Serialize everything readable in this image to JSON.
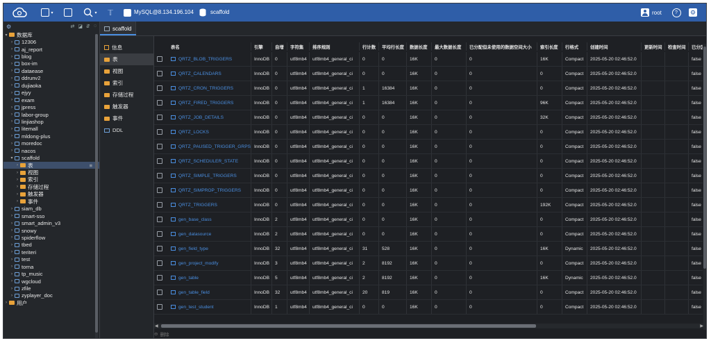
{
  "toolbar": {
    "connection": "MySQL@8.134.196.104",
    "database": "scaffold",
    "user": "root",
    "accent": "#2f5ea8"
  },
  "tree": {
    "root": "数据库",
    "items": [
      {
        "label": "12306",
        "level": 1
      },
      {
        "label": "aj_report",
        "level": 1
      },
      {
        "label": "blog",
        "level": 1
      },
      {
        "label": "box-im",
        "level": 1
      },
      {
        "label": "dataease",
        "level": 1
      },
      {
        "label": "ddrunv2",
        "level": 1
      },
      {
        "label": "dujiaoka",
        "level": 1
      },
      {
        "label": "ejyy",
        "level": 1
      },
      {
        "label": "exam",
        "level": 1
      },
      {
        "label": "jpress",
        "level": 1
      },
      {
        "label": "labor-group",
        "level": 1
      },
      {
        "label": "linjiashop",
        "level": 1
      },
      {
        "label": "litemall",
        "level": 1
      },
      {
        "label": "mldong-plus",
        "level": 1
      },
      {
        "label": "moredoc",
        "level": 1
      },
      {
        "label": "nacos",
        "level": 1
      },
      {
        "label": "scaffold",
        "level": 1,
        "expanded": true
      },
      {
        "label": "表",
        "level": 2,
        "folder": true,
        "selected": true
      },
      {
        "label": "视图",
        "level": 2,
        "folder": true
      },
      {
        "label": "索引",
        "level": 2,
        "folder": true
      },
      {
        "label": "存储过程",
        "level": 2,
        "folder": true
      },
      {
        "label": "触发器",
        "level": 2,
        "folder": true
      },
      {
        "label": "事件",
        "level": 2,
        "folder": true
      },
      {
        "label": "siam_db",
        "level": 1
      },
      {
        "label": "smart-sso",
        "level": 1
      },
      {
        "label": "smart_admin_v3",
        "level": 1
      },
      {
        "label": "snowy",
        "level": 1
      },
      {
        "label": "spiderflow",
        "level": 1
      },
      {
        "label": "tbed",
        "level": 1
      },
      {
        "label": "teriteri",
        "level": 1
      },
      {
        "label": "test",
        "level": 1
      },
      {
        "label": "torna",
        "level": 1
      },
      {
        "label": "tp_music",
        "level": 1
      },
      {
        "label": "wgcloud",
        "level": 1
      },
      {
        "label": "zfile",
        "level": 1
      },
      {
        "label": "zyplayer_doc",
        "level": 1
      },
      {
        "label": "用户",
        "level": 0,
        "folder": true
      }
    ]
  },
  "tab": {
    "label": "scaffold"
  },
  "categories": [
    {
      "label": "信息",
      "icon": "info-icon"
    },
    {
      "label": "表",
      "icon": "folder-icon",
      "selected": true
    },
    {
      "label": "视图",
      "icon": "folder-icon"
    },
    {
      "label": "索引",
      "icon": "folder-icon"
    },
    {
      "label": "存储过程",
      "icon": "folder-icon"
    },
    {
      "label": "触发器",
      "icon": "folder-icon"
    },
    {
      "label": "事件",
      "icon": "folder-icon"
    },
    {
      "label": "DDL",
      "icon": "ddl-icon"
    }
  ],
  "table": {
    "headers": [
      "表名",
      "引擎",
      "自增",
      "字符集",
      "排序规则",
      "行计数",
      "平均行长度",
      "数据长度",
      "最大数据长度",
      "已分配但未使用的数据空间大小",
      "索引长度",
      "行格式",
      "创建时间",
      "更新时间",
      "检查时间",
      "已分区"
    ],
    "rows": [
      [
        "QRTZ_BLOB_TRIGGERS",
        "InnoDB",
        "0",
        "utf8mb4",
        "utf8mb4_general_ci",
        "0",
        "0",
        "16K",
        "0",
        "0",
        "16K",
        "Compact",
        "2025-05-20 02:46:52.0",
        "",
        "",
        "false"
      ],
      [
        "QRTZ_CALENDARS",
        "InnoDB",
        "0",
        "utf8mb4",
        "utf8mb4_general_ci",
        "0",
        "0",
        "16K",
        "0",
        "0",
        "0",
        "Compact",
        "2025-05-20 02:46:52.0",
        "",
        "",
        "false"
      ],
      [
        "QRTZ_CRON_TRIGGERS",
        "InnoDB",
        "0",
        "utf8mb4",
        "utf8mb4_general_ci",
        "1",
        "16384",
        "16K",
        "0",
        "0",
        "0",
        "Compact",
        "2025-05-20 02:46:52.0",
        "",
        "",
        "false"
      ],
      [
        "QRTZ_FIRED_TRIGGERS",
        "InnoDB",
        "0",
        "utf8mb4",
        "utf8mb4_general_ci",
        "1",
        "16384",
        "16K",
        "0",
        "0",
        "96K",
        "Compact",
        "2025-05-20 02:46:52.0",
        "",
        "",
        "false"
      ],
      [
        "QRTZ_JOB_DETAILS",
        "InnoDB",
        "0",
        "utf8mb4",
        "utf8mb4_general_ci",
        "0",
        "0",
        "16K",
        "0",
        "0",
        "32K",
        "Compact",
        "2025-05-20 02:46:52.0",
        "",
        "",
        "false"
      ],
      [
        "QRTZ_LOCKS",
        "InnoDB",
        "0",
        "utf8mb4",
        "utf8mb4_general_ci",
        "0",
        "0",
        "16K",
        "0",
        "0",
        "0",
        "Compact",
        "2025-05-20 02:46:52.0",
        "",
        "",
        "false"
      ],
      [
        "QRTZ_PAUSED_TRIGGER_GRPS",
        "InnoDB",
        "0",
        "utf8mb4",
        "utf8mb4_general_ci",
        "0",
        "0",
        "16K",
        "0",
        "0",
        "0",
        "Compact",
        "2025-05-20 02:46:52.0",
        "",
        "",
        "false"
      ],
      [
        "QRTZ_SCHEDULER_STATE",
        "InnoDB",
        "0",
        "utf8mb4",
        "utf8mb4_general_ci",
        "0",
        "0",
        "16K",
        "0",
        "0",
        "0",
        "Compact",
        "2025-05-20 02:46:52.0",
        "",
        "",
        "false"
      ],
      [
        "QRTZ_SIMPLE_TRIGGERS",
        "InnoDB",
        "0",
        "utf8mb4",
        "utf8mb4_general_ci",
        "0",
        "0",
        "16K",
        "0",
        "0",
        "0",
        "Compact",
        "2025-05-20 02:46:52.0",
        "",
        "",
        "false"
      ],
      [
        "QRTZ_SIMPROP_TRIGGERS",
        "InnoDB",
        "0",
        "utf8mb4",
        "utf8mb4_general_ci",
        "0",
        "0",
        "16K",
        "0",
        "0",
        "0",
        "Compact",
        "2025-05-20 02:46:52.0",
        "",
        "",
        "false"
      ],
      [
        "QRTZ_TRIGGERS",
        "InnoDB",
        "0",
        "utf8mb4",
        "utf8mb4_general_ci",
        "0",
        "0",
        "16K",
        "0",
        "0",
        "192K",
        "Compact",
        "2025-05-20 02:46:52.0",
        "",
        "",
        "false"
      ],
      [
        "gen_base_class",
        "InnoDB",
        "2",
        "utf8mb4",
        "utf8mb4_general_ci",
        "0",
        "0",
        "16K",
        "0",
        "0",
        "0",
        "Compact",
        "2025-05-20 02:46:52.0",
        "",
        "",
        "false"
      ],
      [
        "gen_datasource",
        "InnoDB",
        "2",
        "utf8mb4",
        "utf8mb4_general_ci",
        "0",
        "0",
        "16K",
        "0",
        "0",
        "0",
        "Compact",
        "2025-05-20 02:46:52.0",
        "",
        "",
        "false"
      ],
      [
        "gen_field_type",
        "InnoDB",
        "32",
        "utf8mb4",
        "utf8mb4_general_ci",
        "31",
        "528",
        "16K",
        "0",
        "0",
        "16K",
        "Dynamic",
        "2025-05-20 02:46:52.0",
        "",
        "",
        "false"
      ],
      [
        "gen_project_modify",
        "InnoDB",
        "3",
        "utf8mb4",
        "utf8mb4_general_ci",
        "2",
        "8192",
        "16K",
        "0",
        "0",
        "0",
        "Compact",
        "2025-05-20 02:46:52.0",
        "",
        "",
        "false"
      ],
      [
        "gen_table",
        "InnoDB",
        "5",
        "utf8mb4",
        "utf8mb4_general_ci",
        "2",
        "8192",
        "16K",
        "0",
        "0",
        "16K",
        "Dynamic",
        "2025-05-20 02:46:52.0",
        "",
        "",
        "false"
      ],
      [
        "gen_table_field",
        "InnoDB",
        "32",
        "utf8mb4",
        "utf8mb4_general_ci",
        "20",
        "819",
        "16K",
        "0",
        "0",
        "0",
        "Compact",
        "2025-05-20 02:46:52.0",
        "",
        "",
        "false"
      ],
      [
        "gen_test_student",
        "InnoDB",
        "1",
        "utf8mb4",
        "utf8mb4_general_ci",
        "0",
        "0",
        "16K",
        "0",
        "0",
        "0",
        "Compact",
        "2025-05-20 02:46:52.0",
        "",
        "",
        "false"
      ]
    ]
  },
  "status": {
    "label": "删除"
  }
}
